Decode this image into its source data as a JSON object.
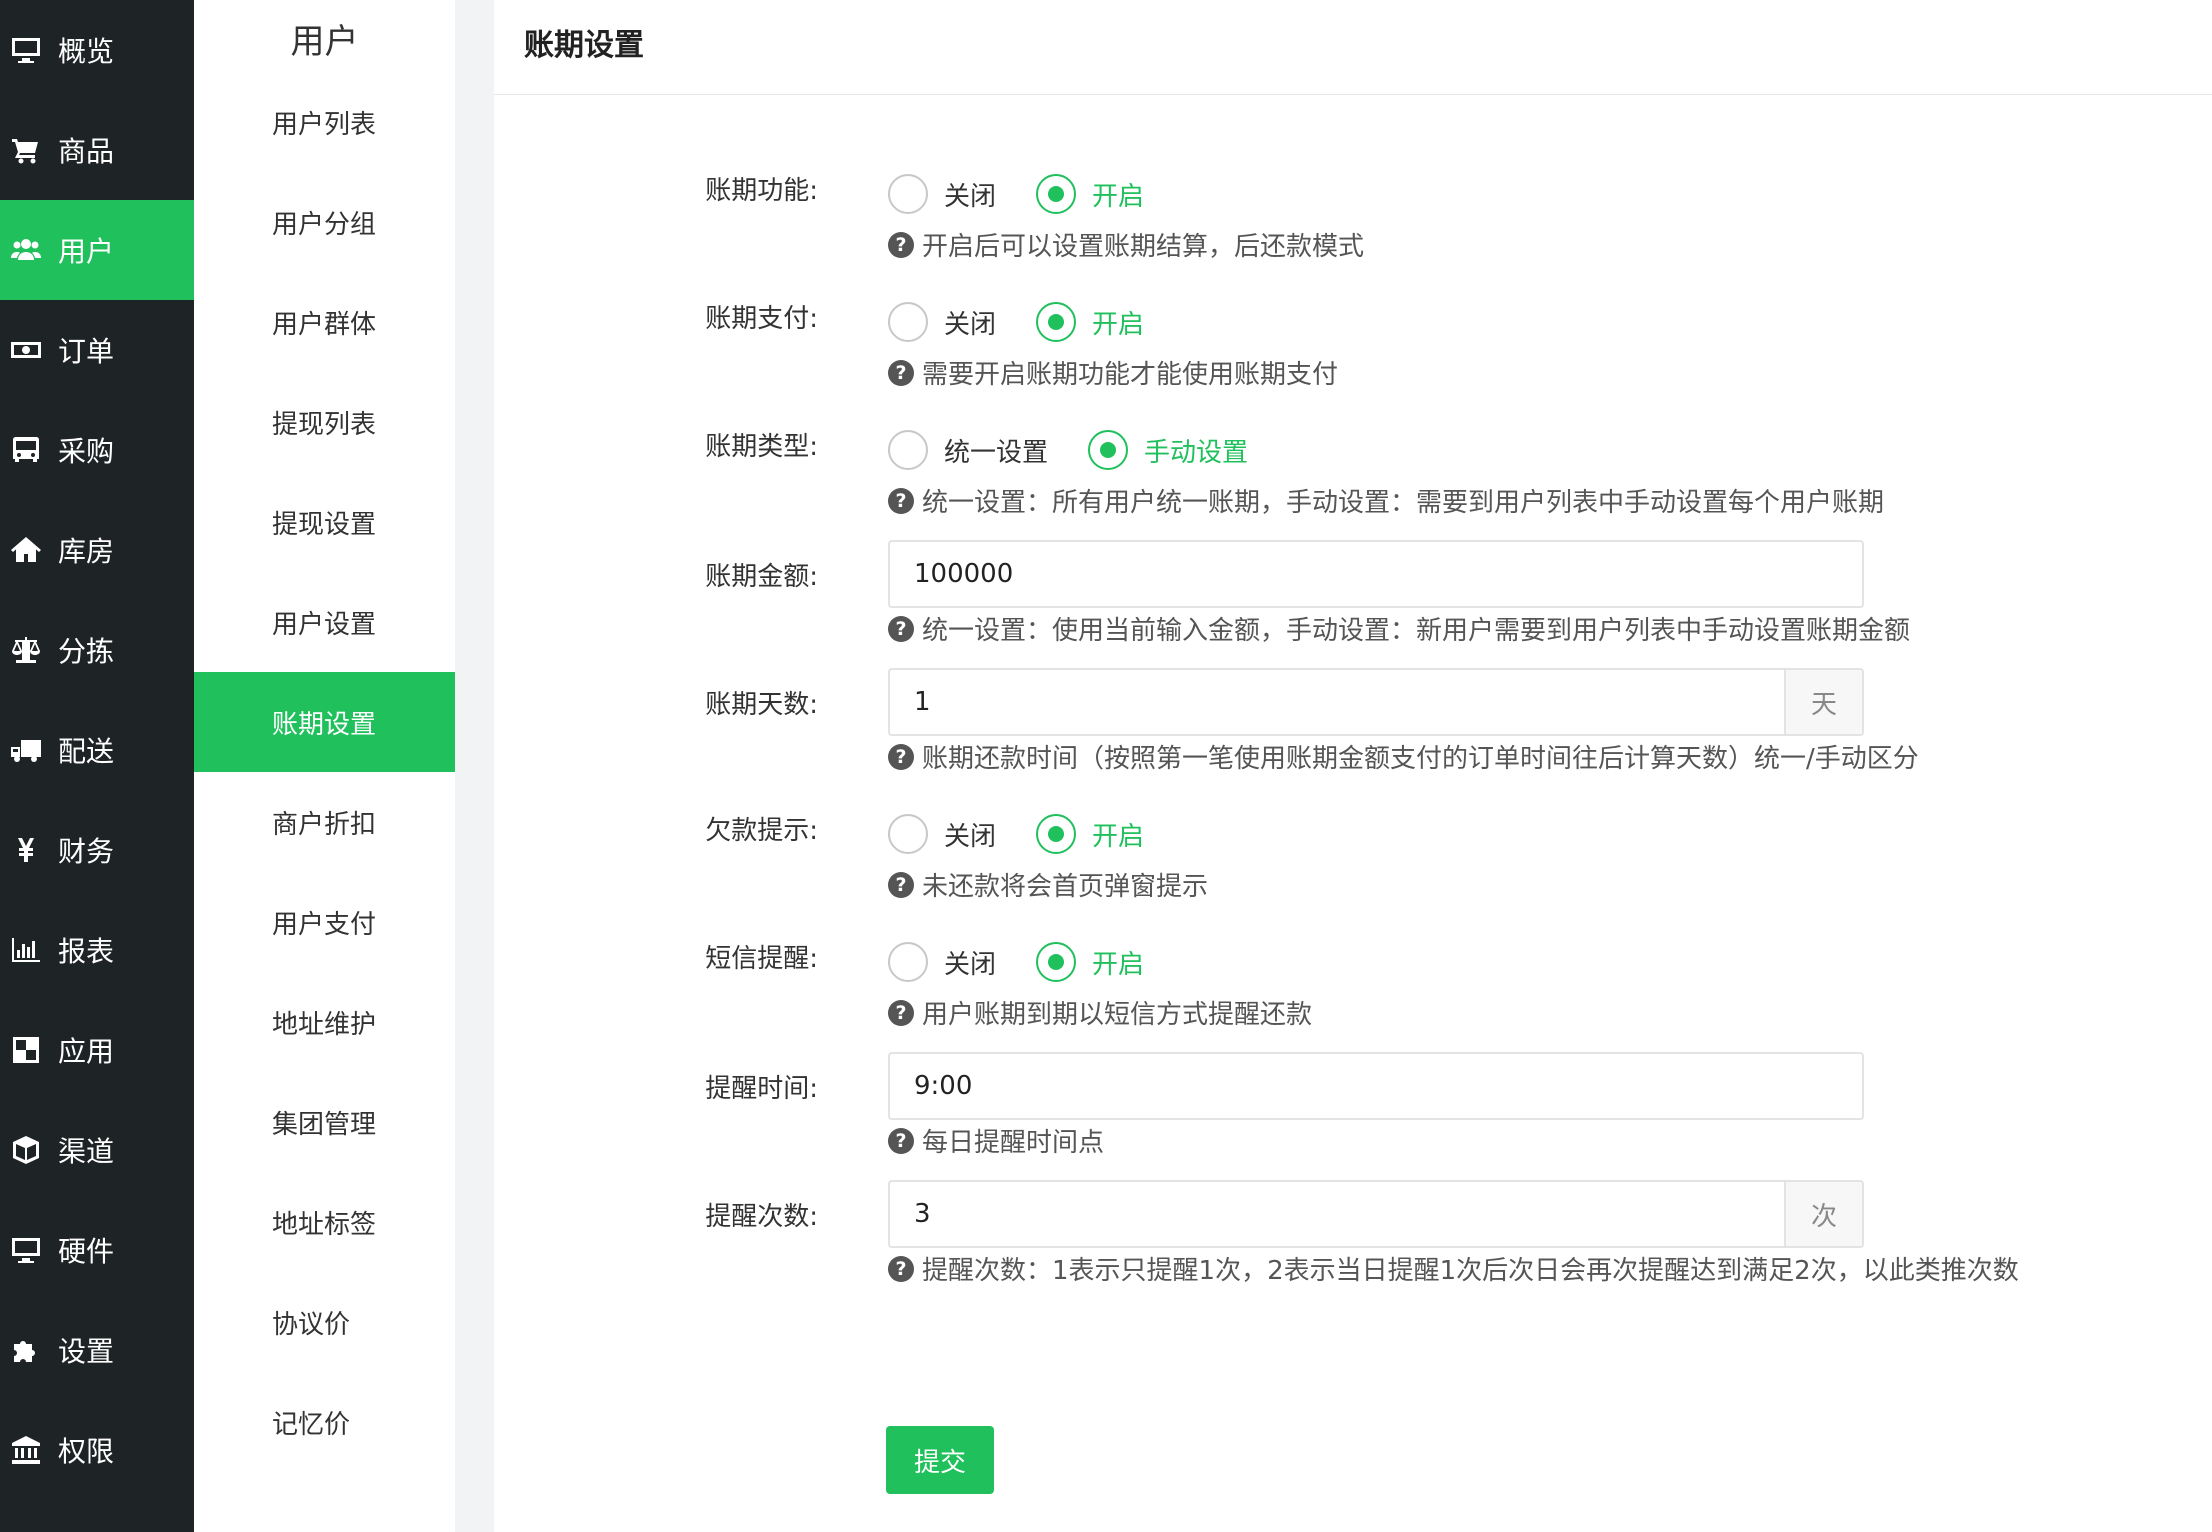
{
  "rail": {
    "items": [
      {
        "label": "概览",
        "icon": "monitor-icon"
      },
      {
        "label": "商品",
        "icon": "cart-icon"
      },
      {
        "label": "用户",
        "icon": "users-icon",
        "active": true
      },
      {
        "label": "订单",
        "icon": "money-icon"
      },
      {
        "label": "采购",
        "icon": "bus-icon"
      },
      {
        "label": "库房",
        "icon": "home-icon"
      },
      {
        "label": "分拣",
        "icon": "scale-icon"
      },
      {
        "label": "配送",
        "icon": "truck-icon"
      },
      {
        "label": "财务",
        "icon": "yen-icon"
      },
      {
        "label": "报表",
        "icon": "bar-chart-icon"
      },
      {
        "label": "应用",
        "icon": "apps-icon"
      },
      {
        "label": "渠道",
        "icon": "cube-icon"
      },
      {
        "label": "硬件",
        "icon": "desktop-icon"
      },
      {
        "label": "设置",
        "icon": "puzzle-icon"
      },
      {
        "label": "权限",
        "icon": "bank-icon"
      }
    ]
  },
  "submenu": {
    "title": "用户",
    "items": [
      "用户列表",
      "用户分组",
      "用户群体",
      "提现列表",
      "提现设置",
      "用户设置",
      "账期设置",
      "商户折扣",
      "用户支付",
      "地址维护",
      "集团管理",
      "地址标签",
      "协议价",
      "记忆价"
    ],
    "active_index": 6
  },
  "page": {
    "title": "账期设置"
  },
  "form": {
    "credit_function": {
      "label": "账期功能:",
      "options": [
        "关闭",
        "开启"
      ],
      "selected": "开启",
      "help": "开启后可以设置账期结算，后还款模式"
    },
    "credit_payment": {
      "label": "账期支付:",
      "options": [
        "关闭",
        "开启"
      ],
      "selected": "开启",
      "help": "需要开启账期功能才能使用账期支付"
    },
    "credit_type": {
      "label": "账期类型:",
      "options": [
        "统一设置",
        "手动设置"
      ],
      "selected": "手动设置",
      "help": "统一设置：所有用户统一账期，手动设置：需要到用户列表中手动设置每个用户账期"
    },
    "credit_amount": {
      "label": "账期金额:",
      "value": "100000",
      "help": "统一设置：使用当前输入金额，手动设置：新用户需要到用户列表中手动设置账期金额"
    },
    "credit_days": {
      "label": "账期天数:",
      "value": "1",
      "addon": "天",
      "help": "账期还款时间（按照第一笔使用账期金额支付的订单时间往后计算天数）统一/手动区分"
    },
    "arrears_notice": {
      "label": "欠款提示:",
      "options": [
        "关闭",
        "开启"
      ],
      "selected": "开启",
      "help": "未还款将会首页弹窗提示"
    },
    "sms_reminder": {
      "label": "短信提醒:",
      "options": [
        "关闭",
        "开启"
      ],
      "selected": "开启",
      "help": "用户账期到期以短信方式提醒还款"
    },
    "reminder_time": {
      "label": "提醒时间:",
      "value": "9:00",
      "help": "每日提醒时间点"
    },
    "reminder_count": {
      "label": "提醒次数:",
      "value": "3",
      "addon": "次",
      "help": "提醒次数：1表示只提醒1次，2表示当日提醒1次后次日会再次提醒达到满足2次，以此类推次数"
    },
    "submit_label": "提交"
  },
  "colors": {
    "accent": "#20c05c",
    "rail_bg": "#1e2326"
  }
}
